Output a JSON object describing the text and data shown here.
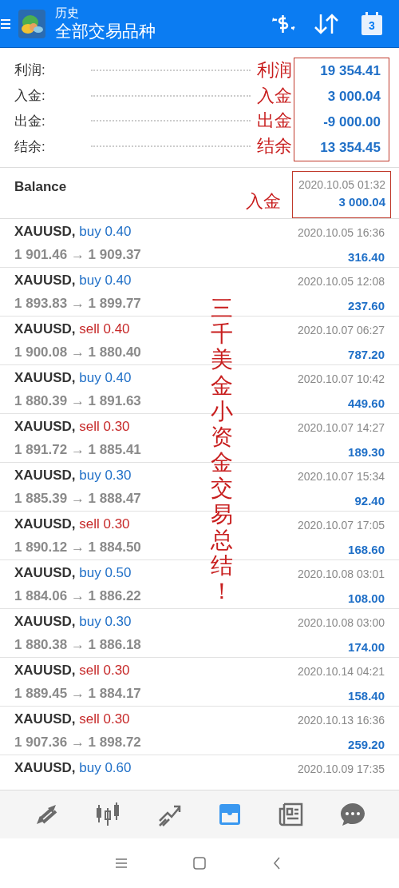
{
  "header": {
    "title": "历史",
    "subtitle": "全部交易品种",
    "calendar_day": "3"
  },
  "summary": [
    {
      "label": "利润:",
      "value": "19 354.41",
      "annotation": "利润"
    },
    {
      "label": "入金:",
      "value": "3 000.04",
      "annotation": "入金"
    },
    {
      "label": "出金:",
      "value": "-9 000.00",
      "annotation": "出金"
    },
    {
      "label": "结余:",
      "value": "13 354.45",
      "annotation": "结余"
    }
  ],
  "balance": {
    "label": "Balance",
    "time": "2020.10.05 01:32",
    "amount": "3 000.04",
    "annotation": "入金"
  },
  "overlay_note": "三千美金小资金交易总结！",
  "trades": [
    {
      "symbol": "XAUUSD,",
      "kind": "buy",
      "order": "buy 0.40",
      "prices": "1 901.46 → 1 909.37",
      "time": "2020.10.05 16:36",
      "profit": "316.40"
    },
    {
      "symbol": "XAUUSD,",
      "kind": "buy",
      "order": "buy 0.40",
      "prices": "1 893.83 → 1 899.77",
      "time": "2020.10.05 12:08",
      "profit": "237.60"
    },
    {
      "symbol": "XAUUSD,",
      "kind": "sell",
      "order": "sell 0.40",
      "prices": "1 900.08 → 1 880.40",
      "time": "2020.10.07 06:27",
      "profit": "787.20"
    },
    {
      "symbol": "XAUUSD,",
      "kind": "buy",
      "order": "buy 0.40",
      "prices": "1 880.39 → 1 891.63",
      "time": "2020.10.07 10:42",
      "profit": "449.60"
    },
    {
      "symbol": "XAUUSD,",
      "kind": "sell",
      "order": "sell 0.30",
      "prices": "1 891.72 → 1 885.41",
      "time": "2020.10.07 14:27",
      "profit": "189.30"
    },
    {
      "symbol": "XAUUSD,",
      "kind": "buy",
      "order": "buy 0.30",
      "prices": "1 885.39 → 1 888.47",
      "time": "2020.10.07 15:34",
      "profit": "92.40"
    },
    {
      "symbol": "XAUUSD,",
      "kind": "sell",
      "order": "sell 0.30",
      "prices": "1 890.12 → 1 884.50",
      "time": "2020.10.07 17:05",
      "profit": "168.60"
    },
    {
      "symbol": "XAUUSD,",
      "kind": "buy",
      "order": "buy 0.50",
      "prices": "1 884.06 → 1 886.22",
      "time": "2020.10.08 03:01",
      "profit": "108.00"
    },
    {
      "symbol": "XAUUSD,",
      "kind": "buy",
      "order": "buy 0.30",
      "prices": "1 880.38 → 1 886.18",
      "time": "2020.10.08 03:00",
      "profit": "174.00"
    },
    {
      "symbol": "XAUUSD,",
      "kind": "sell",
      "order": "sell 0.30",
      "prices": "1 889.45 → 1 884.17",
      "time": "2020.10.14 04:21",
      "profit": "158.40"
    },
    {
      "symbol": "XAUUSD,",
      "kind": "sell",
      "order": "sell 0.30",
      "prices": "1 907.36 → 1 898.72",
      "time": "2020.10.13 16:36",
      "profit": "259.20"
    },
    {
      "symbol": "XAUUSD,",
      "kind": "buy",
      "order": "buy 0.60",
      "time": "2020.10.09 17:35"
    }
  ],
  "bottom_nav": [
    {
      "selected": false
    },
    {
      "selected": false
    },
    {
      "selected": false
    },
    {
      "selected": true
    },
    {
      "selected": false
    },
    {
      "selected": false
    }
  ]
}
